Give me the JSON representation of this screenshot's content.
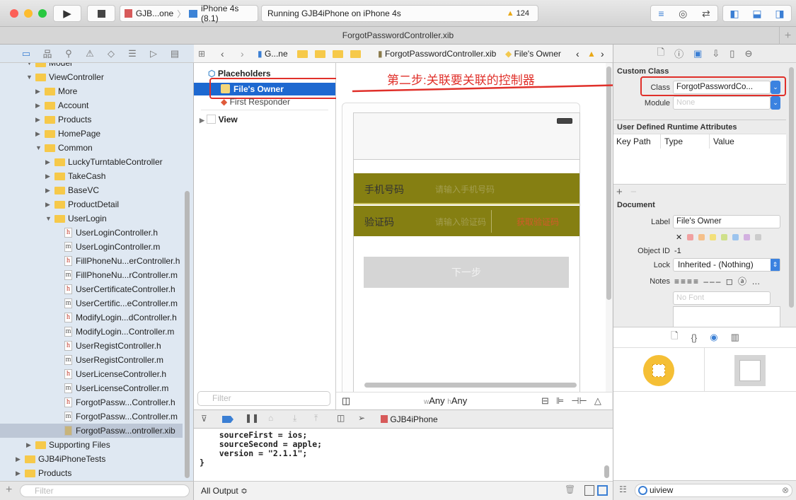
{
  "toolbar": {
    "scheme": "GJB...one",
    "device": "iPhone 4s (8.1)",
    "status": "Running GJB4iPhone on iPhone 4s",
    "warnings": "124"
  },
  "tab_title": "ForgotPasswordController.xib",
  "navigator": {
    "items": [
      {
        "label": "Model",
        "level": 1,
        "kind": "folder",
        "state": "open"
      },
      {
        "label": "ViewController",
        "level": 1,
        "kind": "folder",
        "state": "open"
      },
      {
        "label": "More",
        "level": 2,
        "kind": "folder",
        "state": "closed"
      },
      {
        "label": "Account",
        "level": 2,
        "kind": "folder",
        "state": "closed"
      },
      {
        "label": "Products",
        "level": 2,
        "kind": "folder",
        "state": "closed"
      },
      {
        "label": "HomePage",
        "level": 2,
        "kind": "folder",
        "state": "closed"
      },
      {
        "label": "Common",
        "level": 2,
        "kind": "folder",
        "state": "open"
      },
      {
        "label": "LuckyTurntableController",
        "level": 3,
        "kind": "folder",
        "state": "closed"
      },
      {
        "label": "TakeCash",
        "level": 3,
        "kind": "folder",
        "state": "closed"
      },
      {
        "label": "BaseVC",
        "level": 3,
        "kind": "folder",
        "state": "closed"
      },
      {
        "label": "ProductDetail",
        "level": 3,
        "kind": "folder",
        "state": "closed"
      },
      {
        "label": "UserLogin",
        "level": 3,
        "kind": "folder",
        "state": "open"
      },
      {
        "label": "UserLoginController.h",
        "level": 4,
        "kind": "h"
      },
      {
        "label": "UserLoginController.m",
        "level": 4,
        "kind": "m"
      },
      {
        "label": "FillPhoneNu...erController.h",
        "level": 4,
        "kind": "h"
      },
      {
        "label": "FillPhoneNu...rController.m",
        "level": 4,
        "kind": "m"
      },
      {
        "label": "UserCertificateController.h",
        "level": 4,
        "kind": "h"
      },
      {
        "label": "UserCertific...eController.m",
        "level": 4,
        "kind": "m"
      },
      {
        "label": "ModifyLogin...dController.h",
        "level": 4,
        "kind": "h"
      },
      {
        "label": "ModifyLogin...Controller.m",
        "level": 4,
        "kind": "m"
      },
      {
        "label": "UserRegistController.h",
        "level": 4,
        "kind": "h"
      },
      {
        "label": "UserRegistController.m",
        "level": 4,
        "kind": "m"
      },
      {
        "label": "UserLicenseController.h",
        "level": 4,
        "kind": "h"
      },
      {
        "label": "UserLicenseController.m",
        "level": 4,
        "kind": "m"
      },
      {
        "label": "ForgotPassw...Controller.h",
        "level": 4,
        "kind": "h"
      },
      {
        "label": "ForgotPassw...Controller.m",
        "level": 4,
        "kind": "m"
      },
      {
        "label": "ForgotPassw...ontroller.xib",
        "level": 4,
        "kind": "xib",
        "selected": true
      },
      {
        "label": "Supporting Files",
        "level": 1,
        "kind": "folder",
        "state": "closed"
      },
      {
        "label": "GJB4iPhoneTests",
        "level": 0,
        "kind": "folder",
        "state": "closed"
      },
      {
        "label": "Products",
        "level": 0,
        "kind": "folder",
        "state": "closed"
      }
    ],
    "filter_placeholder": "Filter"
  },
  "jumpbar": {
    "project": "G...ne",
    "file": "ForgotPasswordController.xib",
    "object": "File's Owner"
  },
  "outline": {
    "placeholders": "Placeholders",
    "files_owner": "File's Owner",
    "first_responder": "First Responder",
    "view": "View",
    "filter_placeholder": "Filter"
  },
  "annotation": {
    "text": "第二步:关联要关联的控制器",
    "color": "#e0302a"
  },
  "phone": {
    "phone_label": "手机号码",
    "phone_placeholder": "请输入手机号码",
    "code_label": "验证码",
    "code_placeholder": "请输入验证码",
    "get_code": "获取验证码",
    "next": "下一步",
    "form_bg": "#857f12"
  },
  "size_class": {
    "w": "w",
    "w_val": "Any",
    "h": "h",
    "h_val": "Any"
  },
  "debug": {
    "target": "GJB4iPhone"
  },
  "console": {
    "lines": [
      "    sourceFirst = ios;",
      "    sourceSecond = apple;",
      "    version = \"2.1.1\";",
      "}"
    ],
    "output_selector": "All Output ≎"
  },
  "inspector": {
    "custom_class": "Custom Class",
    "class_label": "Class",
    "class_value": "ForgotPasswordCo...",
    "module_label": "Module",
    "module_placeholder": "None",
    "udra": "User Defined Runtime Attributes",
    "cols": [
      "Key Path",
      "Type",
      "Value"
    ],
    "document": "Document",
    "label_label": "Label",
    "label_value": "File's Owner",
    "object_id_label": "Object ID",
    "object_id": "-1",
    "lock_label": "Lock",
    "lock_value": "Inherited - (Nothing)",
    "notes_label": "Notes",
    "font_placeholder": "No Font",
    "swatches": [
      "#f0a0a0",
      "#f5c08a",
      "#f3e07a",
      "#cfe08a",
      "#9cc4ee",
      "#d2b0e0",
      "#cccccc"
    ],
    "library_search": "uiview"
  }
}
